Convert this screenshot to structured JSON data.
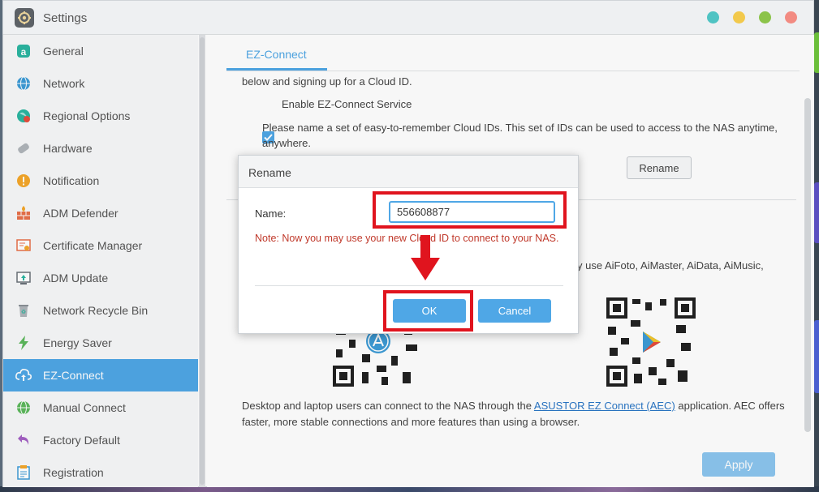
{
  "window": {
    "title": "Settings"
  },
  "window_controls": [
    {
      "name": "info",
      "color": "#4fc3c3"
    },
    {
      "name": "minimize",
      "color": "#f2c94c"
    },
    {
      "name": "maximize",
      "color": "#8bc34a"
    },
    {
      "name": "close",
      "color": "#f28b82"
    }
  ],
  "sidebar": {
    "items": [
      {
        "label": "General",
        "icon": "general-icon"
      },
      {
        "label": "Network",
        "icon": "globe-icon"
      },
      {
        "label": "Regional Options",
        "icon": "regional-icon"
      },
      {
        "label": "Hardware",
        "icon": "hardware-icon"
      },
      {
        "label": "Notification",
        "icon": "notification-icon"
      },
      {
        "label": "ADM Defender",
        "icon": "firewall-icon"
      },
      {
        "label": "Certificate Manager",
        "icon": "certificate-icon"
      },
      {
        "label": "ADM Update",
        "icon": "update-icon"
      },
      {
        "label": "Network Recycle Bin",
        "icon": "recycle-icon"
      },
      {
        "label": "Energy Saver",
        "icon": "energy-icon"
      },
      {
        "label": "EZ-Connect",
        "icon": "cloud-icon",
        "active": true
      },
      {
        "label": "Manual Connect",
        "icon": "manual-connect-icon"
      },
      {
        "label": "Factory Default",
        "icon": "undo-icon"
      },
      {
        "label": "Registration",
        "icon": "registration-icon"
      }
    ]
  },
  "content": {
    "tab": "EZ-Connect",
    "intro_text": "below and signing up for a Cloud ID.",
    "enable_checkbox": {
      "label": "Enable EZ-Connect Service",
      "checked": true
    },
    "cloud_id_desc_line1": "Please name a set of easy-to-remember Cloud IDs. This set of IDs can be used to access to the NAS anytime,",
    "cloud_id_desc_line2": "anywhere.",
    "rename_button": "Rename",
    "app_hint": "y use AiFoto, AiMaster, AiData, AiMusic,",
    "desktop_text_1": "Desktop and laptop users can connect to the NAS through the ",
    "desktop_link": "ASUSTOR EZ Connect (AEC)",
    "desktop_text_2": " application. AEC offers",
    "desktop_text_3": "faster, more stable connections and more features than using a browser.",
    "apply_button": "Apply"
  },
  "dialog": {
    "title": "Rename",
    "name_label": "Name:",
    "name_value": "556608877",
    "note": "Note: Now you may use your new Cloud ID to connect to your NAS.",
    "ok_button": "OK",
    "cancel_button": "Cancel"
  },
  "colors": {
    "accent": "#4fa7e6",
    "highlight": "#e0141e",
    "note": "#c0392b"
  }
}
